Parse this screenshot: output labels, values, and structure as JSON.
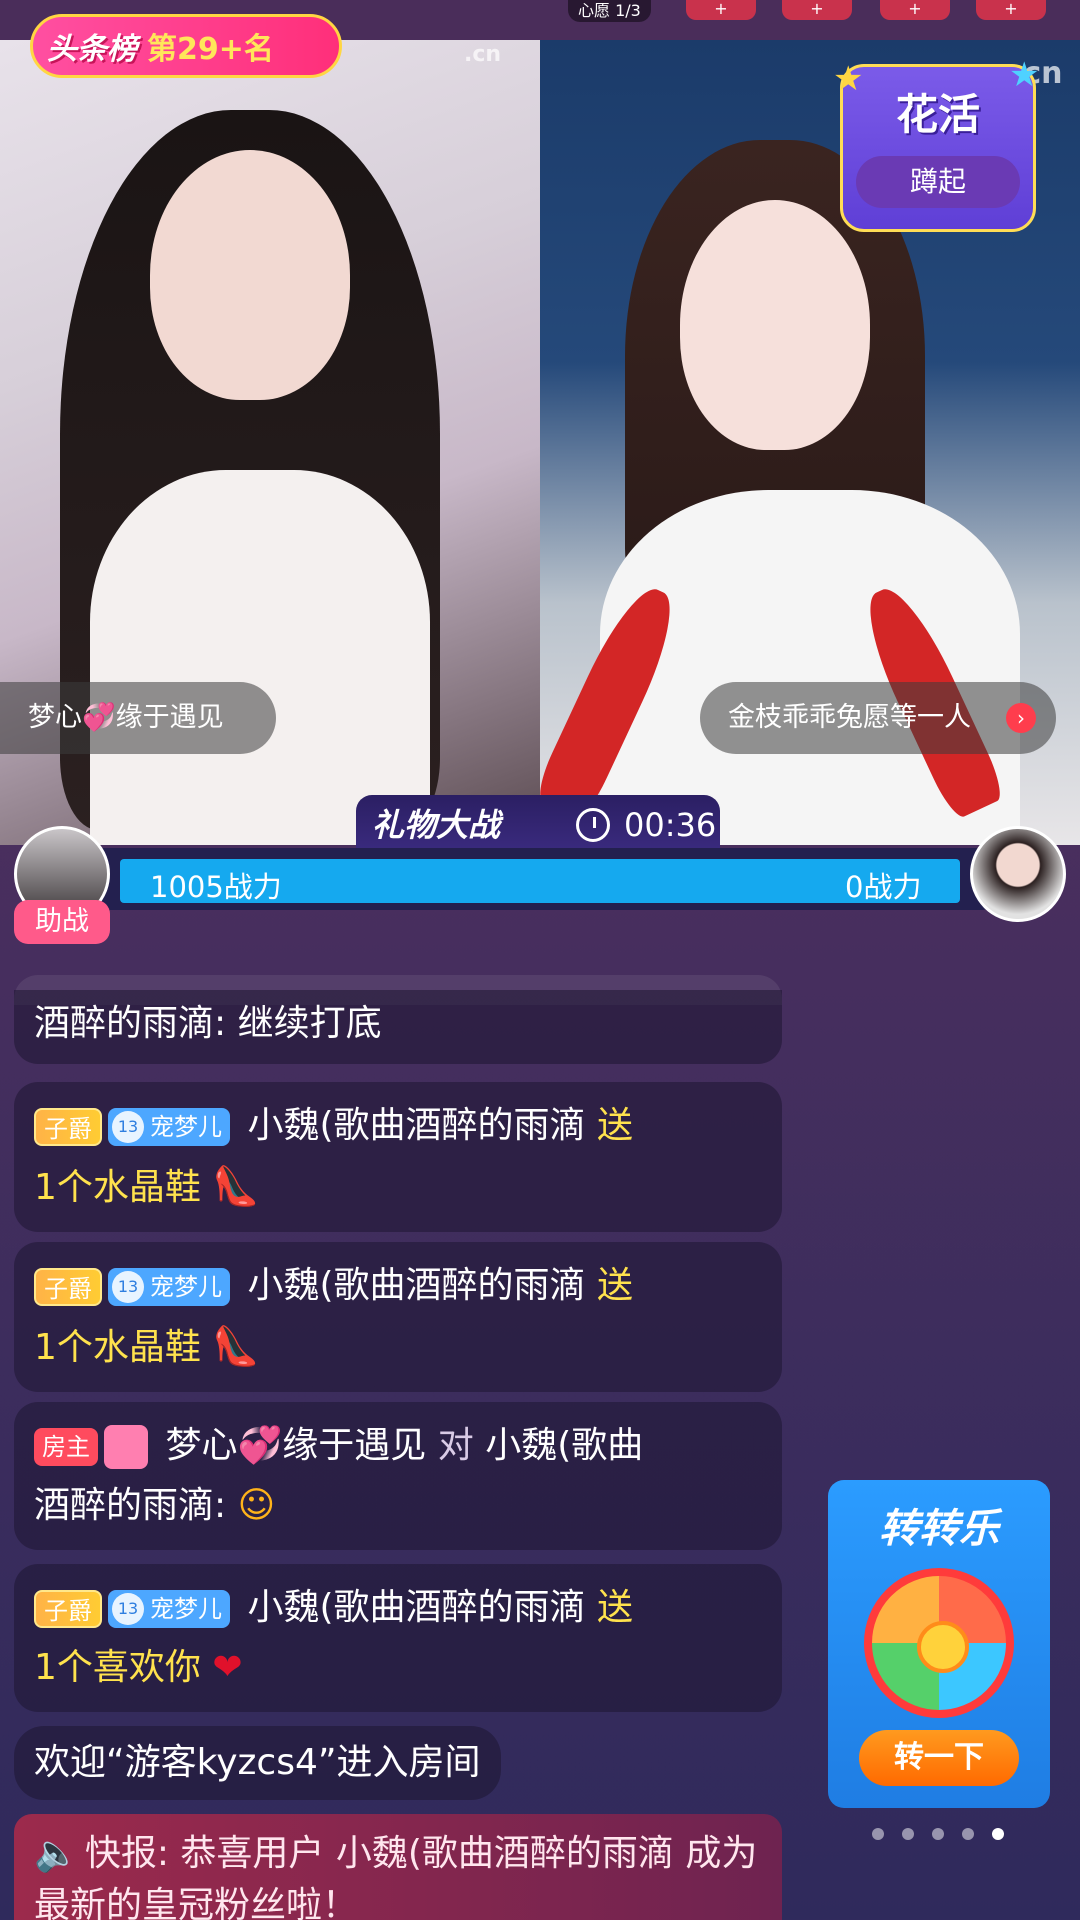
{
  "top_strip": {
    "wish_label": "心愿",
    "wish_progress": "1/3",
    "buttons": [
      "+",
      "+",
      "+",
      "+"
    ]
  },
  "rank_badge": {
    "title": "头条榜",
    "rank": "第29+名"
  },
  "activity_badge": {
    "title": "花活",
    "action": "蹲起"
  },
  "watermark": ".cn",
  "host_left": {
    "name_part1": "梦心",
    "name_part2": "缘于遇见"
  },
  "host_right": {
    "name": "金枝乖乖兔愿等一人"
  },
  "pk": {
    "title": "礼物大战",
    "timer": "00:36",
    "left_score": "1005战力",
    "right_score": "0战力",
    "left_score_value": 1005,
    "right_score_value": 0,
    "assist_label": "助战"
  },
  "chat": {
    "partial_msg": {
      "author": "酒醉的雨滴",
      "sep": ":",
      "text": "继续打底"
    },
    "msgs": [
      {
        "rank_badge": "子爵",
        "fan_level": "13",
        "fan_name": "宠梦儿",
        "author": "小魏(歌曲酒醉的雨滴",
        "verb": "送",
        "gift": "1个水晶鞋"
      },
      {
        "rank_badge": "子爵",
        "fan_level": "13",
        "fan_name": "宠梦儿",
        "author": "小魏(歌曲酒醉的雨滴",
        "verb": "送",
        "gift": "1个水晶鞋"
      },
      {
        "rank_badge": "子爵",
        "fan_level": "13",
        "fan_name": "宠梦儿",
        "author": "小魏(歌曲酒醉的雨滴",
        "verb": "送",
        "gift": "1个喜欢你"
      }
    ],
    "host_msg": {
      "badge": "房主",
      "author": "梦心💞缘于遇见",
      "verb": "对",
      "target": "小魏(歌曲",
      "target2": "酒醉的雨滴:"
    },
    "welcome": "欢迎“游客kyzcs4”进入房间",
    "news": "快报: 恭喜用户 小魏(歌曲酒醉的雨滴 成为最新的皇冠粉丝啦！"
  },
  "wheel": {
    "title": "转转乐",
    "button": "转一下",
    "page_count": 5,
    "active_page": 5
  }
}
